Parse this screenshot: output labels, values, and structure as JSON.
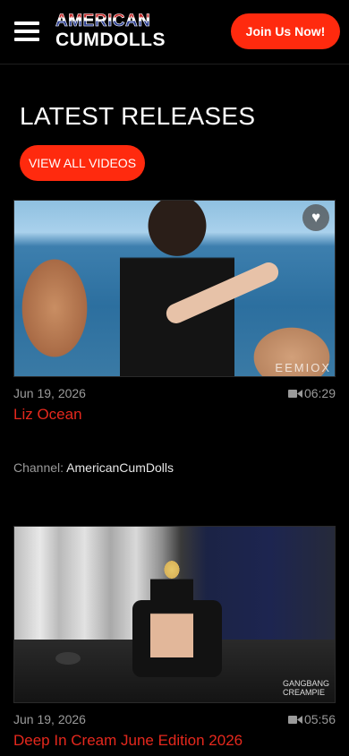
{
  "header": {
    "logo_line1": "AMERICAN",
    "logo_line2": "CUMDOLLS",
    "join_label": "Join Us Now!",
    "menu_icon": "hamburger-menu-icon"
  },
  "main": {
    "section_title": "LATEST RELEASES",
    "view_all_label": "VIEW ALL VIDEOS"
  },
  "videos": [
    {
      "date": "Jun 19, 2026",
      "duration": "06:29",
      "title": "Liz Ocean",
      "channel_label": "Channel:",
      "channel_name": "AmericanCumDolls",
      "watermark": "EEMIOX",
      "favorite_icon": "heart-icon"
    },
    {
      "date": "Jun 19, 2026",
      "duration": "05:56",
      "title": "Deep In Cream June Edition 2026",
      "watermark_line1": "GANGBANG",
      "watermark_line2": "CREAMPIE"
    }
  ],
  "colors": {
    "accent": "#ff2a0e",
    "title_red": "#e5281d",
    "meta_gray": "#9a9a9a",
    "background": "#000000"
  }
}
